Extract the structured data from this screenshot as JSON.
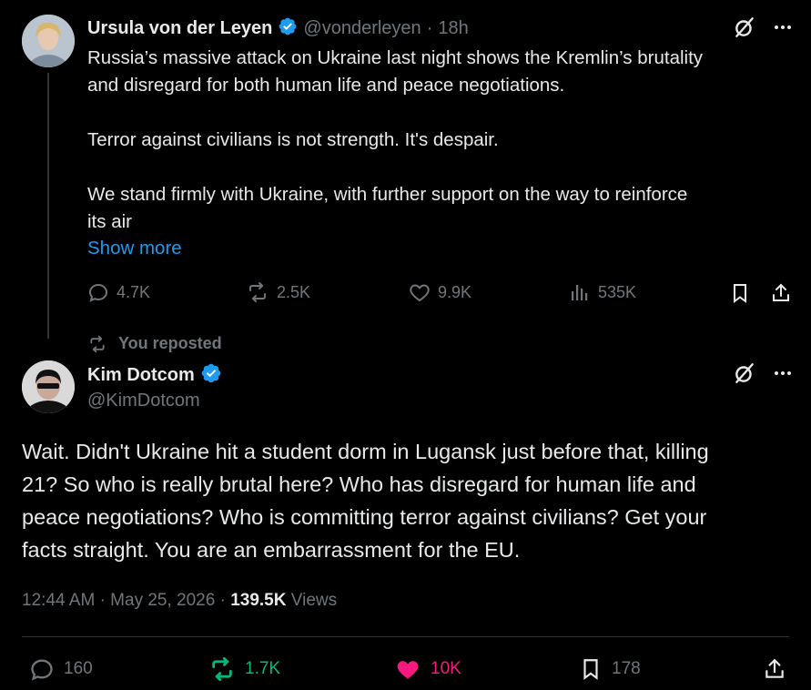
{
  "parent": {
    "name": "Ursula von der Leyen",
    "handle": "@vonderleyen",
    "sep": "·",
    "time": "18h",
    "para1_line1": "Russia’s massive attack on Ukraine last night shows the Kremlin’s brutality",
    "para1_line2": "and disregard for both human life and peace negotiations.",
    "para2": "Terror against civilians is not strength. It's despair.",
    "para3_line1": "We stand firmly with Ukraine, with further support on the way to reinforce",
    "para3_line2": "its air",
    "show_more": "Show more",
    "replies": "4.7K",
    "reposts": "2.5K",
    "likes": "9.9K",
    "views": "535K"
  },
  "repost_label": "You reposted",
  "main": {
    "name": "Kim Dotcom",
    "handle": "@KimDotcom",
    "line1": "Wait. Didn't Ukraine hit a student dorm in Lugansk just before that, killing",
    "line2": "21? So who is really brutal here? Who has disregard for human life and",
    "line3": "peace negotiations? Who is committing terror against civilians? Get your",
    "line4": "facts straight. You are an embarrassment for the EU.",
    "time": "12:44 AM",
    "sep1": "·",
    "date": "May 25, 2026",
    "sep2": "·",
    "views_count": "139.5K",
    "views_label": "Views",
    "replies": "160",
    "reposts": "1.7K",
    "likes": "10K",
    "bookmarks": "178"
  },
  "colors": {
    "background": "#000000",
    "text": "#e7e9ea",
    "muted": "#71767b",
    "link": "#1d9bf0",
    "verified": "#1d9bf0",
    "repost_active": "#00ba7c",
    "like_active": "#f91880"
  },
  "icons": [
    "verified-badge-icon",
    "grok-icon",
    "more-icon",
    "reply-icon",
    "repost-icon",
    "like-icon",
    "views-icon",
    "bookmark-icon",
    "share-icon"
  ]
}
